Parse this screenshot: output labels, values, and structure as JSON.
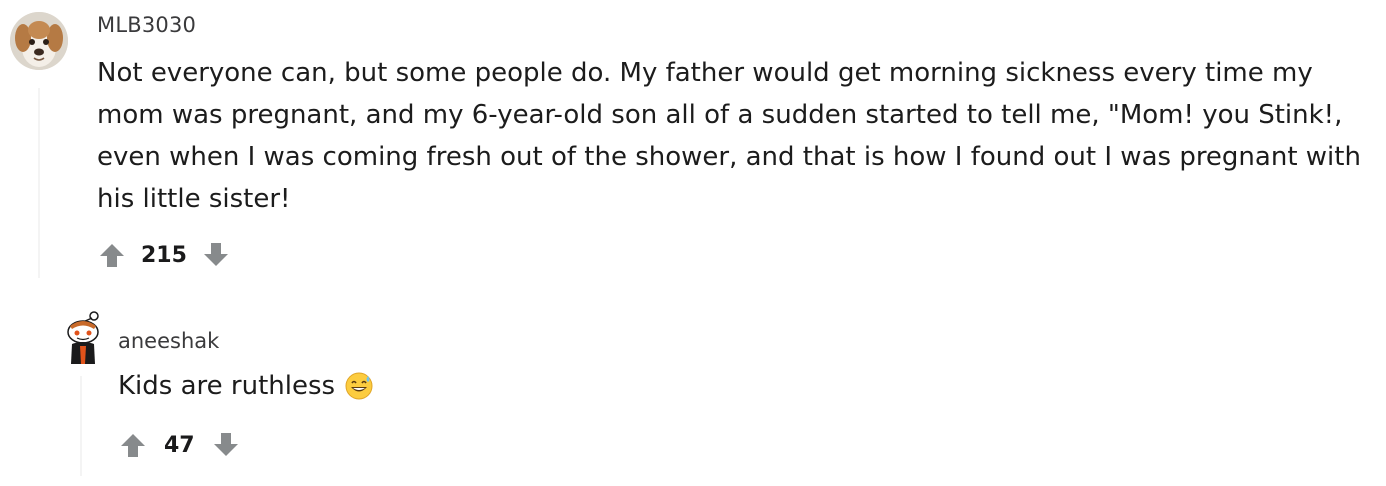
{
  "comments": [
    {
      "username": "MLB3030",
      "body": "Not everyone can, but some people do. My father would get morning sickness every time my mom was pregnant, and my 6-year-old son all of a sudden started to tell me, \"Mom! you Stink!, even when I was coming fresh out of the shower, and that is how I found out I was pregnant with his little sister!",
      "score": "215",
      "avatar_icon": "dog-avatar-icon"
    },
    {
      "username": "aneeshak",
      "body": "Kids are ruthless",
      "score": "47",
      "avatar_icon": "snoo-avatar-icon",
      "emoji_icon": "grinning-sweat-emoji-icon"
    }
  ],
  "colors": {
    "upvote": "#878a8c",
    "downvote": "#878a8c",
    "text": "#1c1c1c",
    "username": "#3a3a3c"
  }
}
